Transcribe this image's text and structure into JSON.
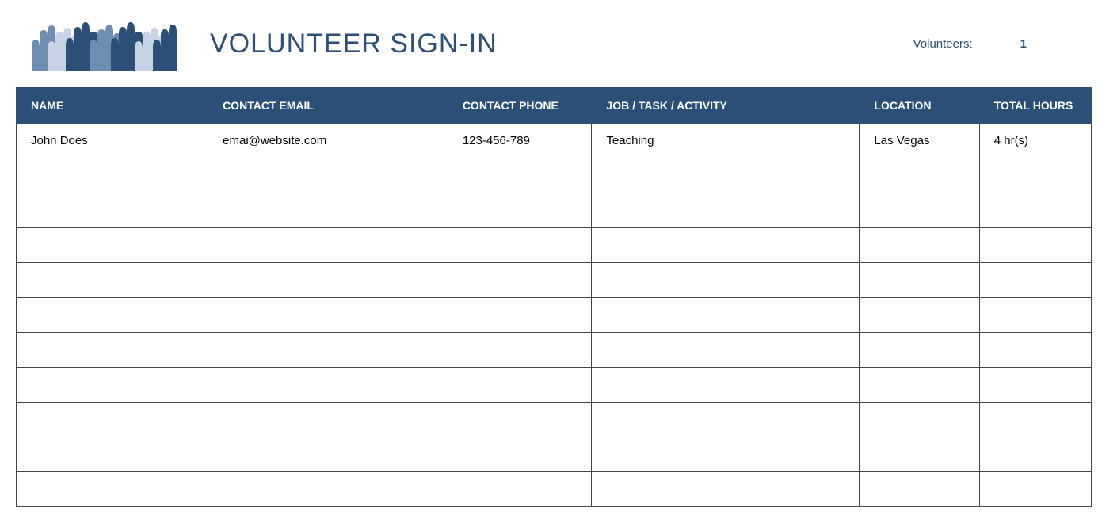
{
  "header": {
    "title": "VOLUNTEER SIGN-IN",
    "summary_label": "Volunteers:",
    "summary_value": "1"
  },
  "table": {
    "columns": [
      "NAME",
      "CONTACT EMAIL",
      "CONTACT PHONE",
      "JOB / TASK / ACTIVITY",
      "LOCATION",
      "TOTAL HOURS"
    ],
    "rows": [
      {
        "name": "John Does",
        "email": "emai@website.com",
        "phone": "123-456-789",
        "job": "Teaching",
        "location": "Las Vegas",
        "hours": "4 hr(s)"
      },
      {
        "name": "",
        "email": "",
        "phone": "",
        "job": "",
        "location": "",
        "hours": ""
      },
      {
        "name": "",
        "email": "",
        "phone": "",
        "job": "",
        "location": "",
        "hours": ""
      },
      {
        "name": "",
        "email": "",
        "phone": "",
        "job": "",
        "location": "",
        "hours": ""
      },
      {
        "name": "",
        "email": "",
        "phone": "",
        "job": "",
        "location": "",
        "hours": ""
      },
      {
        "name": "",
        "email": "",
        "phone": "",
        "job": "",
        "location": "",
        "hours": ""
      },
      {
        "name": "",
        "email": "",
        "phone": "",
        "job": "",
        "location": "",
        "hours": ""
      },
      {
        "name": "",
        "email": "",
        "phone": "",
        "job": "",
        "location": "",
        "hours": ""
      },
      {
        "name": "",
        "email": "",
        "phone": "",
        "job": "",
        "location": "",
        "hours": ""
      },
      {
        "name": "",
        "email": "",
        "phone": "",
        "job": "",
        "location": "",
        "hours": ""
      },
      {
        "name": "",
        "email": "",
        "phone": "",
        "job": "",
        "location": "",
        "hours": ""
      }
    ]
  }
}
